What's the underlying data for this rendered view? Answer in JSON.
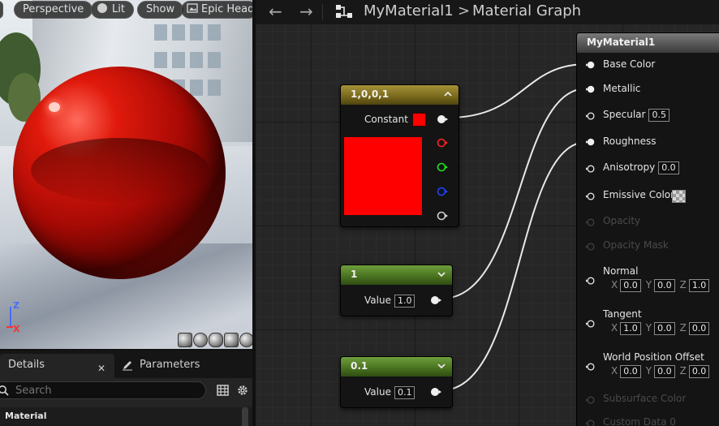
{
  "viewport": {
    "toolbar": {
      "perspective": "Perspective",
      "lit": "Lit",
      "show": "Show",
      "epic": "Epic Head"
    },
    "axis_z": "Z",
    "axis_x": "X"
  },
  "details": {
    "tab_details": "Details",
    "tab_close": "✕",
    "tab_parameters": "Parameters",
    "search_placeholder": "Search",
    "category": "Material"
  },
  "graph": {
    "breadcrumb_asset": "MyMaterial1",
    "breadcrumb_sep": ">",
    "breadcrumb_graph": "Material Graph",
    "nav_back": "←",
    "nav_forward": "→",
    "nodes": {
      "constant3": {
        "title": "1,0,0,1",
        "label": "Constant",
        "color": "#ff0000",
        "header_color": "#8a7a1e"
      },
      "scalar_one": {
        "title": "1",
        "label": "Value",
        "value": "1.0",
        "header_color": "#4e7a26"
      },
      "scalar_rough": {
        "title": "0.1",
        "label": "Value",
        "value": "0.1",
        "header_color": "#4e7a26"
      }
    },
    "material_node": {
      "title": "MyMaterial1",
      "pins": {
        "base_color": "Base Color",
        "metallic": "Metallic",
        "specular": "Specular",
        "specular_value": "0.5",
        "roughness": "Roughness",
        "anisotropy": "Anisotropy",
        "anisotropy_value": "0.0",
        "emissive": "Emissive Color",
        "opacity": "Opacity",
        "opacity_mask": "Opacity Mask",
        "normal": "Normal",
        "normal_x": "0.0",
        "normal_y": "0.0",
        "normal_z": "1.0",
        "tangent": "Tangent",
        "tangent_x": "1.0",
        "tangent_y": "0.0",
        "tangent_z": "0.0",
        "wpo": "World Position Offset",
        "wpo_x": "0.0",
        "wpo_y": "0.0",
        "wpo_z": "0.0",
        "subsurface": "Subsurface Color",
        "custom_data": "Custom Data 0"
      },
      "axis_x": "X",
      "axis_y": "Y",
      "axis_z": "Z"
    }
  },
  "colors": {
    "accent_wire": "#e8e8e8",
    "pin_red": "#ff2020",
    "pin_green": "#20e020",
    "pin_blue": "#2040ff"
  }
}
